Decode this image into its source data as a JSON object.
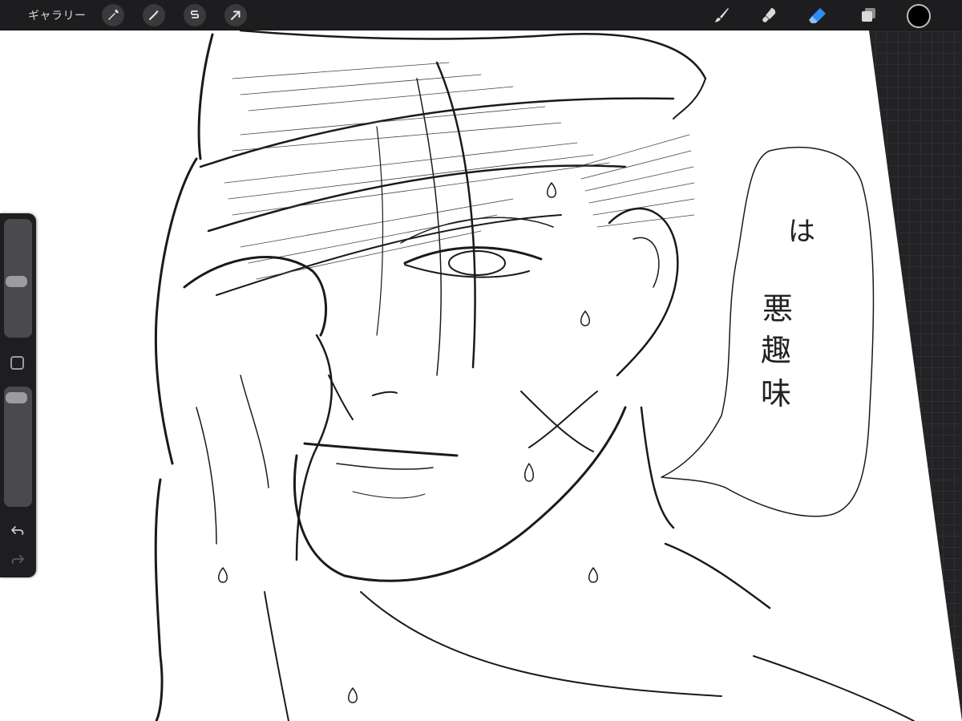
{
  "topbar": {
    "gallery_label": "ギャラリー",
    "left_tools": [
      "wrench-icon",
      "magic-wand-icon",
      "selection-s-icon",
      "transform-arrow-icon"
    ],
    "right_tools": [
      "brush-icon",
      "smudge-icon",
      "eraser-icon",
      "layers-icon"
    ],
    "active_tool": "eraser",
    "accent_color": "#2f8bf5",
    "current_color": "#000000"
  },
  "sidebar": {
    "brush_size_level": 0.47,
    "opacity_level": 0.04,
    "icons": [
      "modify-square-icon",
      "undo-icon",
      "redo-icon"
    ]
  },
  "canvas": {
    "speech_bubble_text_lines": [
      "は",
      "悪",
      "趣",
      "味"
    ]
  }
}
